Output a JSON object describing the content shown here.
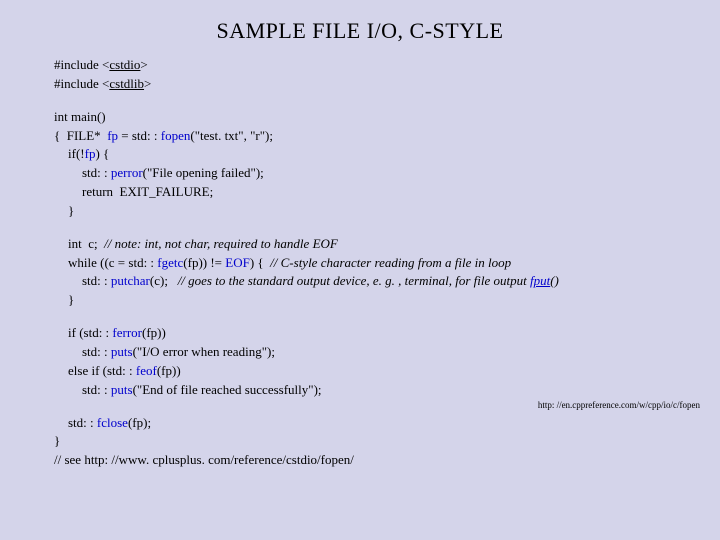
{
  "title": "SAMPLE FILE I/O, C-STYLE",
  "includes": {
    "l1_pre": "#include <",
    "l1_lib": "cstdio",
    "l1_post": ">",
    "l2_pre": "#include <",
    "l2_lib": "cstdlib",
    "l2_post": ">"
  },
  "main": {
    "sig": "int main()",
    "open_brace": "{  FILE*  ",
    "fp1": "fp",
    "eq": " = std: : ",
    "fopen": "fopen",
    "fopen_args": "(\"test. txt\", \"r\");",
    "if_pre": "if(!",
    "if_fp": "fp",
    "if_post": ") {",
    "perror_pre": "std: : ",
    "perror": "perror",
    "perror_args": "(\"File opening failed\");",
    "return": "return  EXIT_FAILURE;",
    "brace1": "}"
  },
  "loop": {
    "decl_pre": "int  c;  ",
    "decl_comment": "// note: int, not char, required to handle EOF",
    "while_pre": "while ((c = std: : ",
    "fgetc": "fgetc",
    "while_mid": "(fp)) != ",
    "eof": "EOF",
    "while_post": ") {  ",
    "while_comment": "// C-style character reading from a file in loop",
    "putchar_pre": "std: : ",
    "putchar": "putchar",
    "putchar_post": "(c);   ",
    "putchar_comment_pre": "// goes to the standard output device, e. g. , terminal, for file output ",
    "fput": "fput",
    "putchar_comment_post": "()",
    "brace2": "}"
  },
  "tail": {
    "ferror_pre": "if (std: : ",
    "ferror": "ferror",
    "ferror_post": "(fp))",
    "puts1_pre": "std: : ",
    "puts1": "puts",
    "puts1_args": "(\"I/O error when reading\");",
    "elseif_pre": "else if (std: : ",
    "feof": "feof",
    "elseif_post": "(fp))",
    "puts2_pre": "std: : ",
    "puts2": "puts",
    "puts2_args": "(\"End of file reached successfully\");",
    "fclose_pre": "std: : ",
    "fclose": "fclose",
    "fclose_post": "(fp);",
    "end_brace": "}",
    "see": "// see http: //www. cplusplus. com/reference/cstdio/fopen/"
  },
  "footnote": "http: //en.cppreference.com/w/cpp/io/c/fopen"
}
